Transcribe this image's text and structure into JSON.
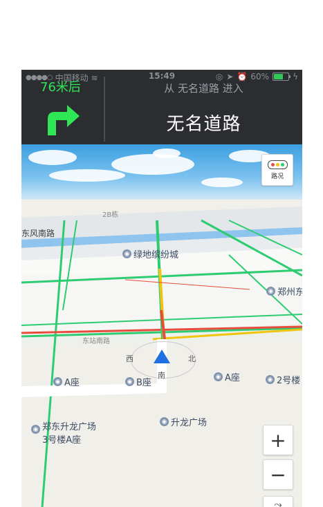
{
  "status": {
    "carrier": "中国移动",
    "time": "15:49",
    "battery": "60%"
  },
  "nav": {
    "distance": "76米后",
    "from_text": "从 无名道路 进入",
    "road_name": "无名道路",
    "turn_icon": "turn-right-arrow-icon",
    "accent": "#2fe657"
  },
  "map": {
    "labels": {
      "b2": "2B栋",
      "fengnan": "东风南路",
      "green": "绿地缤纷城",
      "station": "东站南路",
      "zhengzhou": "郑州东",
      "dong_road": "东站南路"
    },
    "pois": {
      "a_left": "A座",
      "b_seat": "B座",
      "a_right": "A座",
      "bld2": "2号楼",
      "zd1": "郑东升龙广场",
      "zd2": "3号楼A座",
      "shenglong": "升龙广场"
    },
    "traffic_label": "路况",
    "zoom_in": "+",
    "zoom_out": "−"
  }
}
